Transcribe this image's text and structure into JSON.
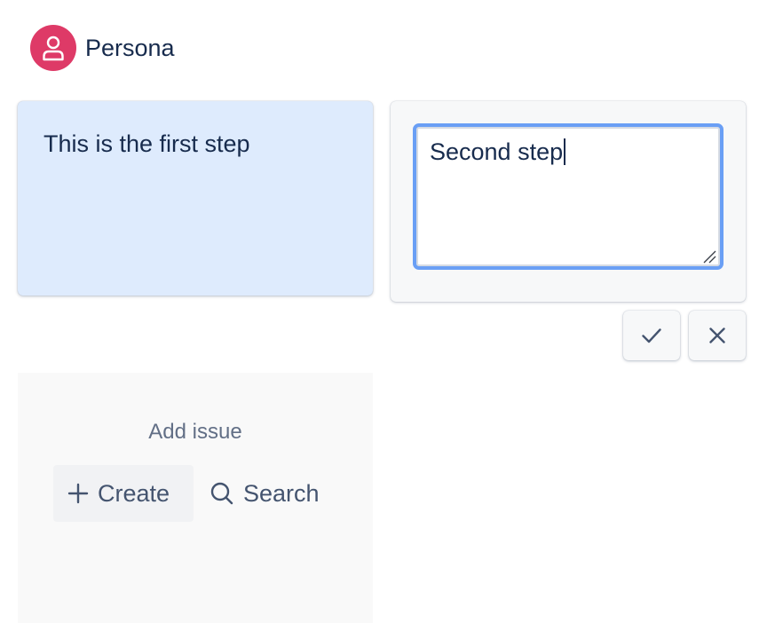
{
  "persona": {
    "name": "Persona",
    "avatar_color": "#de3a67",
    "icon": "user-icon"
  },
  "steps": [
    {
      "text": "This is the first step",
      "background": "#deebfd"
    }
  ],
  "editor": {
    "value": "Second step",
    "border_color": "#6a9ff5",
    "confirm_icon": "check-icon",
    "cancel_icon": "close-icon"
  },
  "add_issue": {
    "title": "Add issue",
    "create_label": "Create",
    "create_icon": "plus-icon",
    "search_label": "Search",
    "search_icon": "search-icon"
  }
}
